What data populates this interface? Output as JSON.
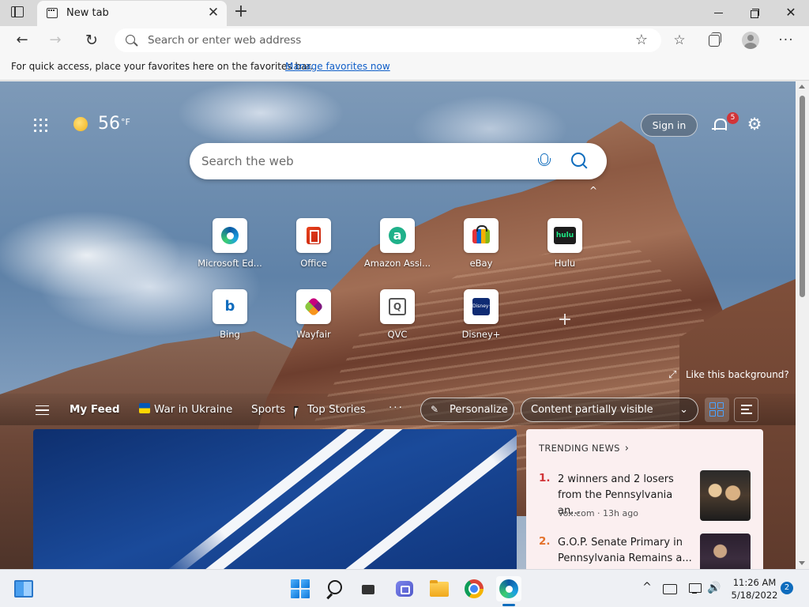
{
  "browser": {
    "tab_title": "New tab",
    "tab_close": "✕",
    "new_tab": "+",
    "address_placeholder": "Search or enter web address",
    "back": "←",
    "forward": "→",
    "refresh": "↻",
    "add_favorite": "☆",
    "favorites": "☆",
    "more": "···",
    "minimize": "",
    "restore": "",
    "close": "✕"
  },
  "favorites_bar": {
    "text": "For quick access, place your favorites here on the favorites bar.",
    "link": "Manage favorites now"
  },
  "newtab": {
    "weather_temp": "56",
    "weather_unit": "°F",
    "sign_in": "Sign in",
    "notification_count": "5",
    "settings": "⚙",
    "search_placeholder": "Search the web",
    "collapse": "^",
    "like_background": "Like this background?",
    "expand": "⤢",
    "add_quick_link": "+",
    "quick_links": [
      {
        "label": "Microsoft Ed...",
        "icon": "edge-icon"
      },
      {
        "label": "Office",
        "icon": "office-icon"
      },
      {
        "label": "Amazon Assi...",
        "icon": "amazon-icon",
        "glyph": "a"
      },
      {
        "label": "eBay",
        "icon": "ebay-icon"
      },
      {
        "label": "Hulu",
        "icon": "hulu-icon",
        "glyph": "hulu"
      },
      {
        "label": "Bing",
        "icon": "bing-icon",
        "glyph": "b"
      },
      {
        "label": "Wayfair",
        "icon": "wayfair-icon"
      },
      {
        "label": "QVC",
        "icon": "qvc-icon",
        "glyph": "Q"
      },
      {
        "label": "Disney+",
        "icon": "disney-icon",
        "glyph": "Disney+"
      }
    ]
  },
  "feed": {
    "tabs": [
      {
        "label": "My Feed"
      },
      {
        "label": "War in Ukraine"
      },
      {
        "label": "Sports"
      },
      {
        "label": "Top Stories"
      }
    ],
    "more": "···",
    "personalize": "Personalize",
    "pencil": "✎",
    "content_visibility": "Content partially visible",
    "chevron": "⌄",
    "trending": {
      "heading": "TRENDING NEWS",
      "chevron": "›",
      "items": [
        {
          "rank": "1.",
          "title": "2 winners and 2 losers from the Pennsylvania an...",
          "source": "Vox.com · 13h ago"
        },
        {
          "rank": "2.",
          "title": "G.O.P. Senate Primary in Pennsylvania Remains a...",
          "source": ""
        }
      ]
    }
  },
  "taskbar": {
    "tray_chevron": "^",
    "volume": "🔊",
    "time": "11:26 AM",
    "date": "5/18/2022",
    "notification_count": "2"
  },
  "colors": {
    "accent": "#0f6cbd",
    "rank_1": "#d13438",
    "rank_2": "#e3722b",
    "trending_bg": "#fbeff0"
  }
}
